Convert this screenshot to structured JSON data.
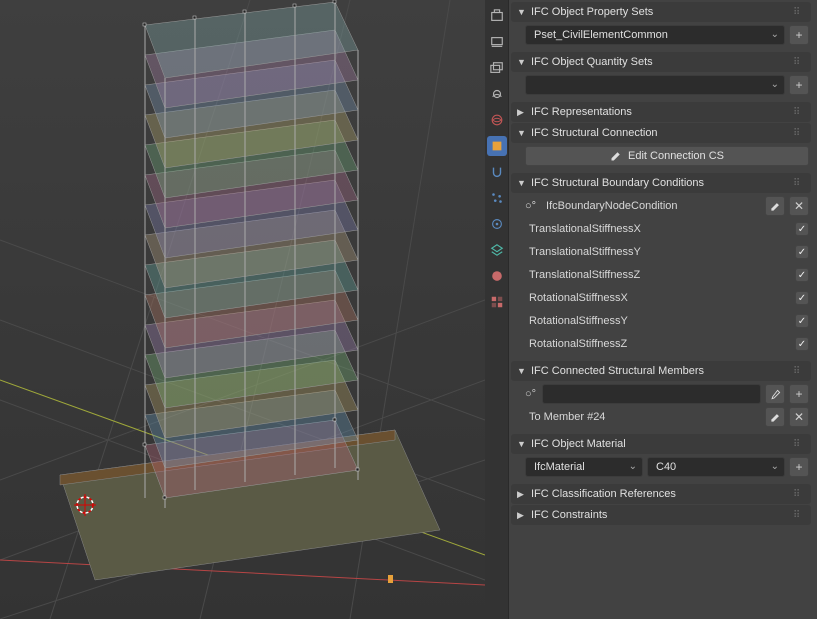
{
  "panels": {
    "propsets": {
      "title": "IFC Object Property Sets",
      "dropdown": "Pset_CivilElementCommon"
    },
    "qtysets": {
      "title": "IFC Object Quantity Sets",
      "dropdown": ""
    },
    "representations": {
      "title": "IFC Representations"
    },
    "structconn": {
      "title": "IFC Structural Connection",
      "button": "Edit Connection CS"
    },
    "boundary": {
      "title": "IFC Structural Boundary Conditions",
      "condition": "IfcBoundaryNodeCondition",
      "fields": [
        "TranslationalStiffnessX",
        "TranslationalStiffnessY",
        "TranslationalStiffnessZ",
        "RotationalStiffnessX",
        "RotationalStiffnessY",
        "RotationalStiffnessZ"
      ]
    },
    "connected": {
      "title": "IFC Connected Structural Members",
      "member": "To Member #24",
      "search": ""
    },
    "material": {
      "title": "IFC Object Material",
      "type": "IfcMaterial",
      "value": "C40"
    },
    "classrefs": {
      "title": "IFC Classification References"
    },
    "constraints": {
      "title": "IFC Constraints"
    }
  }
}
